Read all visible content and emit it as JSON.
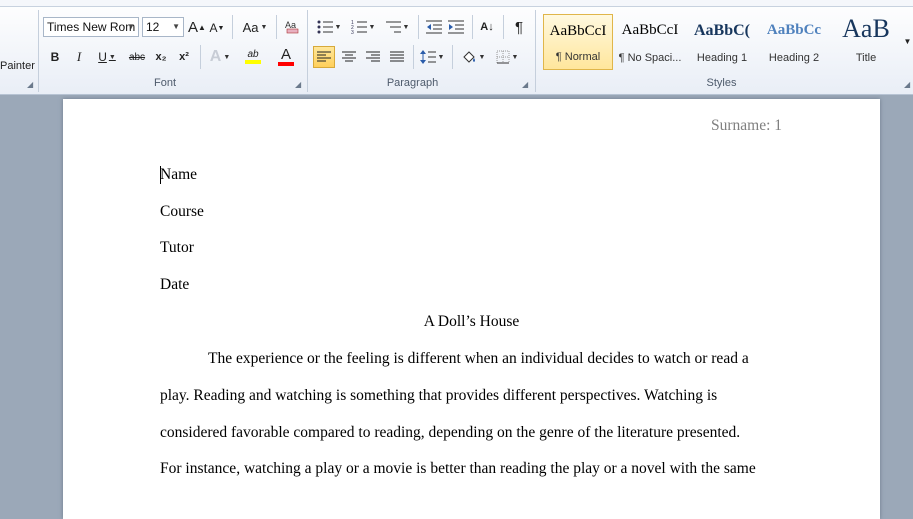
{
  "clipboard": {
    "painter_label": "Painter"
  },
  "font": {
    "name": "Times New Rom",
    "size": "12",
    "group_label": "Font",
    "grow_label": "A",
    "shrink_label": "A",
    "case_label": "Aa",
    "bold_label": "B",
    "italic_label": "I",
    "underline_label": "U",
    "strike_label": "abc",
    "subscript_label": "x₂",
    "superscript_label": "x²",
    "effects_label": "A",
    "highlight_label": "ab",
    "color_label": "A"
  },
  "paragraph": {
    "group_label": "Paragraph",
    "sort_label": "A↓",
    "pilcrow_label": "¶"
  },
  "styles": {
    "group_label": "Styles",
    "items": [
      {
        "sample": "AaBbCcI",
        "name": "¶ Normal"
      },
      {
        "sample": "AaBbCcI",
        "name": "¶ No Spaci..."
      },
      {
        "sample": "AaBbC(",
        "name": "Heading 1"
      },
      {
        "sample": "AaBbCc",
        "name": "Heading 2"
      },
      {
        "sample": "AaB",
        "name": "Title"
      }
    ]
  },
  "colors": {
    "highlight": "#ffff00",
    "font_color": "#ff0000",
    "heading_blue": "#17365d",
    "heading2_blue": "#4f81bd"
  },
  "document": {
    "header": "Surname: 1",
    "lines": [
      "Name",
      "Course",
      "Tutor",
      "Date"
    ],
    "title": "A Doll’s House",
    "body": [
      "The experience or the feeling is different when an individual decides to watch or read a",
      "play. Reading and watching is something that provides different perspectives. Watching is",
      "considered favorable compared to reading, depending on the genre of the literature presented.",
      "For instance, watching a play or a movie is better than reading the play or a novel with the same"
    ]
  }
}
